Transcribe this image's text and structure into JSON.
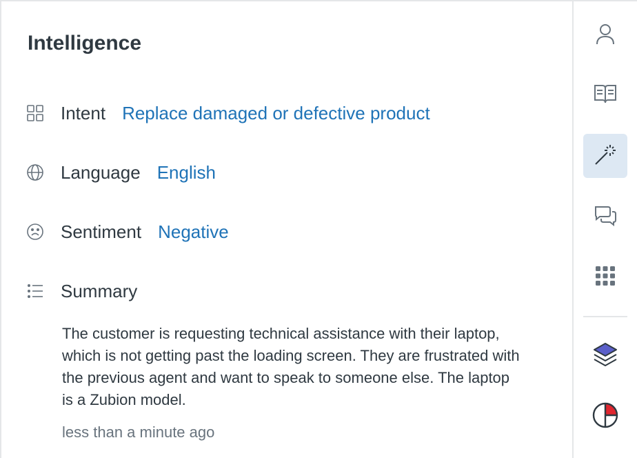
{
  "panel": {
    "title": "Intelligence",
    "fields": [
      {
        "icon": "grid-icon",
        "label": "Intent",
        "value": "Replace damaged or defective product"
      },
      {
        "icon": "globe-icon",
        "label": "Language",
        "value": "English"
      },
      {
        "icon": "sad-face-icon",
        "label": "Sentiment",
        "value": "Negative"
      }
    ],
    "summary": {
      "icon": "list-icon",
      "label": "Summary",
      "text": "The customer is requesting technical assistance with their laptop, which is not getting past the loading screen. They are frustrated with the previous agent and want to speak to someone else. The laptop is a Zubion model.",
      "timestamp": "less than a minute ago"
    }
  },
  "rail": {
    "items": [
      {
        "icon": "user-icon",
        "active": false
      },
      {
        "icon": "book-icon",
        "active": false
      },
      {
        "icon": "magic-wand-icon",
        "active": true
      },
      {
        "icon": "chat-bubbles-icon",
        "active": false
      },
      {
        "icon": "apps-grid-icon",
        "active": false
      },
      {
        "icon": "layers-icon",
        "active": false
      },
      {
        "icon": "pie-chart-icon",
        "active": false
      }
    ]
  },
  "colors": {
    "link": "#1f73b7",
    "text": "#2f3941",
    "muted": "#68737d",
    "active_bg": "#dde8f3",
    "layers_fill": "#5a5fc9",
    "pie_red": "#e0262f"
  }
}
